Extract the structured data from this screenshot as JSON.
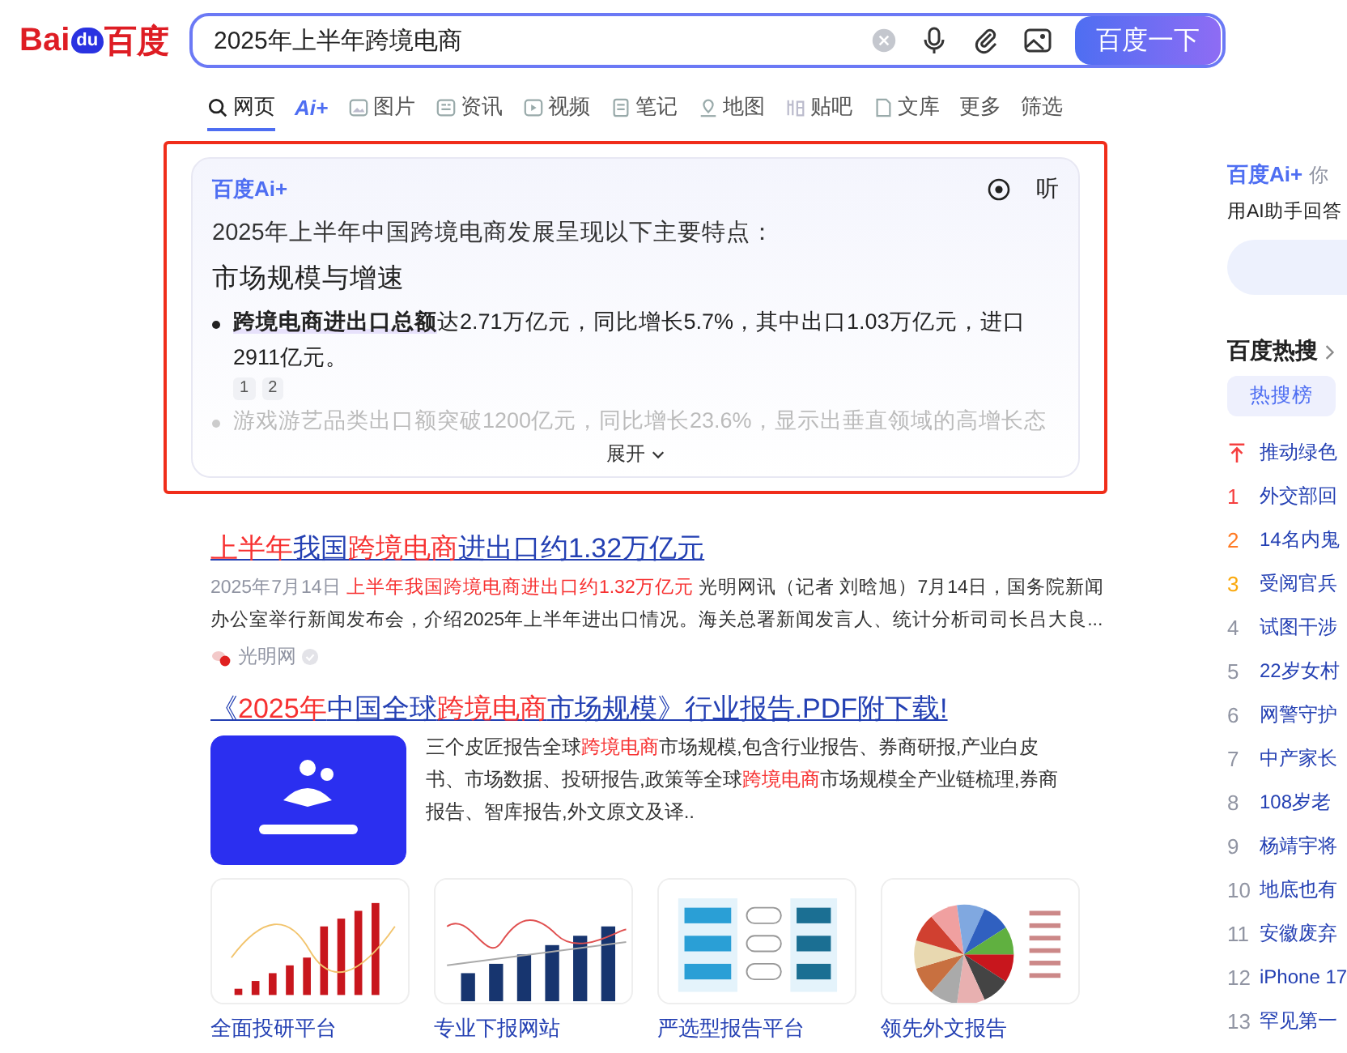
{
  "logo": {
    "left": "Bai",
    "paw": "du",
    "right": "百度"
  },
  "search": {
    "value": "2025年上半年跨境电商",
    "button": "百度一下"
  },
  "tabs": [
    {
      "label": "网页",
      "selected": true
    },
    {
      "label": "Ai+",
      "selected": false
    },
    {
      "label": "图片",
      "selected": false
    },
    {
      "label": "资讯",
      "selected": false
    },
    {
      "label": "视频",
      "selected": false
    },
    {
      "label": "笔记",
      "selected": false
    },
    {
      "label": "地图",
      "selected": false
    },
    {
      "label": "贴吧",
      "selected": false
    },
    {
      "label": "文库",
      "selected": false
    },
    {
      "label": "更多",
      "selected": false
    },
    {
      "label": "筛选",
      "selected": false
    }
  ],
  "ai_card": {
    "brand": "百度Ai+",
    "listen": "听",
    "intro": "2025年上半年中国跨境电商发展呈现以下主要特点：",
    "heading": "市场规模与增速",
    "bullets": [
      {
        "text": "**跨境电商进出口总额**达2.71万亿元，同比增长5.7%，其中出口1.03万亿元，进口2911亿元。",
        "citations": [
          "1",
          "2"
        ],
        "faded": false
      },
      {
        "text": "游戏游艺品类出口额突破1200亿元，同比增长23.6%，显示出垂直领域的高增长态",
        "faded": true
      }
    ],
    "expand": "展开"
  },
  "results": [
    {
      "title": [
        {
          "text": "上半年",
          "hit": true
        },
        {
          "text": "我国",
          "hit": false
        },
        {
          "text": "跨境电商",
          "hit": true
        },
        {
          "text": "进出口约1.32万亿元",
          "hit": false
        }
      ],
      "snippet": [
        {
          "text": "2025年7月14日 ",
          "kind": "date"
        },
        {
          "text": "上半年我国跨境电商进出口约1.32万亿元",
          "kind": "hit"
        },
        {
          "text": " 光明网讯（记者 刘晗旭）7月14日，国务院新闻办公室举行新闻发布会，介绍2025年上半年进出口情况。海关总署新闻发言人、统计分析司司长吕大良...",
          "kind": "plain"
        }
      ],
      "source": "光明网"
    },
    {
      "title": [
        {
          "text": "《",
          "hit": false
        },
        {
          "text": "2025年",
          "hit": true
        },
        {
          "text": "中国全球",
          "hit": false
        },
        {
          "text": "跨境电商",
          "hit": true
        },
        {
          "text": "市场规模》行业报告.PDF附下载!",
          "hit": false
        }
      ],
      "image": {
        "kind": "picture"
      },
      "snippet": [
        {
          "text": "三个皮匠报告全球",
          "kind": "plain"
        },
        {
          "text": "跨境电商",
          "kind": "hit"
        },
        {
          "text": "市场规模,包含行业报告、券商研报,产业白皮书、市场数据、投研报告,政策等全球",
          "kind": "plain"
        },
        {
          "text": "跨境电商",
          "kind": "hit"
        },
        {
          "text": "市场规模全产业链梳理,券商报告、智库报告,外文原文及译..",
          "kind": "plain"
        }
      ],
      "thumbnails": [
        {
          "kind": "picture",
          "caption": "全面投研平台"
        },
        {
          "kind": "picture",
          "caption": "专业下报网站"
        },
        {
          "kind": "picture",
          "caption": "严选型报告平台"
        },
        {
          "kind": "picture",
          "caption": "领先外文报告"
        }
      ]
    }
  ],
  "sidebar": {
    "ai_brand": "百度Ai+",
    "ai_hint": "你",
    "ai_prompt": "用AI助手回答",
    "hot_title": "百度热搜",
    "hot_tab": {
      "label": "热搜榜",
      "selected": true
    },
    "hot_items": [
      {
        "kind": "pinned",
        "text": "推动绿色",
        "color": "#f53f3f"
      },
      {
        "kind": "ranked",
        "rank": "1",
        "text": "外交部回",
        "color": "#f53f3f"
      },
      {
        "kind": "ranked",
        "rank": "2",
        "text": "14名内鬼",
        "color": "#ff7a23"
      },
      {
        "kind": "ranked",
        "rank": "3",
        "text": "受阅官兵",
        "color": "#faa90e"
      },
      {
        "kind": "ranked",
        "rank": "4",
        "text": "试图干涉",
        "color": "#9195a3"
      },
      {
        "kind": "ranked",
        "rank": "5",
        "text": "22岁女村",
        "color": "#9195a3"
      },
      {
        "kind": "ranked",
        "rank": "6",
        "text": "网警守护",
        "color": "#9195a3"
      },
      {
        "kind": "ranked",
        "rank": "7",
        "text": "中产家长",
        "color": "#9195a3"
      },
      {
        "kind": "ranked",
        "rank": "8",
        "text": "108岁老",
        "color": "#9195a3"
      },
      {
        "kind": "ranked",
        "rank": "9",
        "text": "杨靖宇将",
        "color": "#9195a3"
      },
      {
        "kind": "ranked",
        "rank": "10",
        "text": "地底也有",
        "color": "#9195a3"
      },
      {
        "kind": "ranked",
        "rank": "11",
        "text": "安徽废弃",
        "color": "#9195a3"
      },
      {
        "kind": "ranked",
        "rank": "12",
        "text": "iPhone 17",
        "color": "#9195a3"
      },
      {
        "kind": "ranked",
        "rank": "13",
        "text": "罕见第一",
        "color": "#9195a3"
      }
    ]
  }
}
